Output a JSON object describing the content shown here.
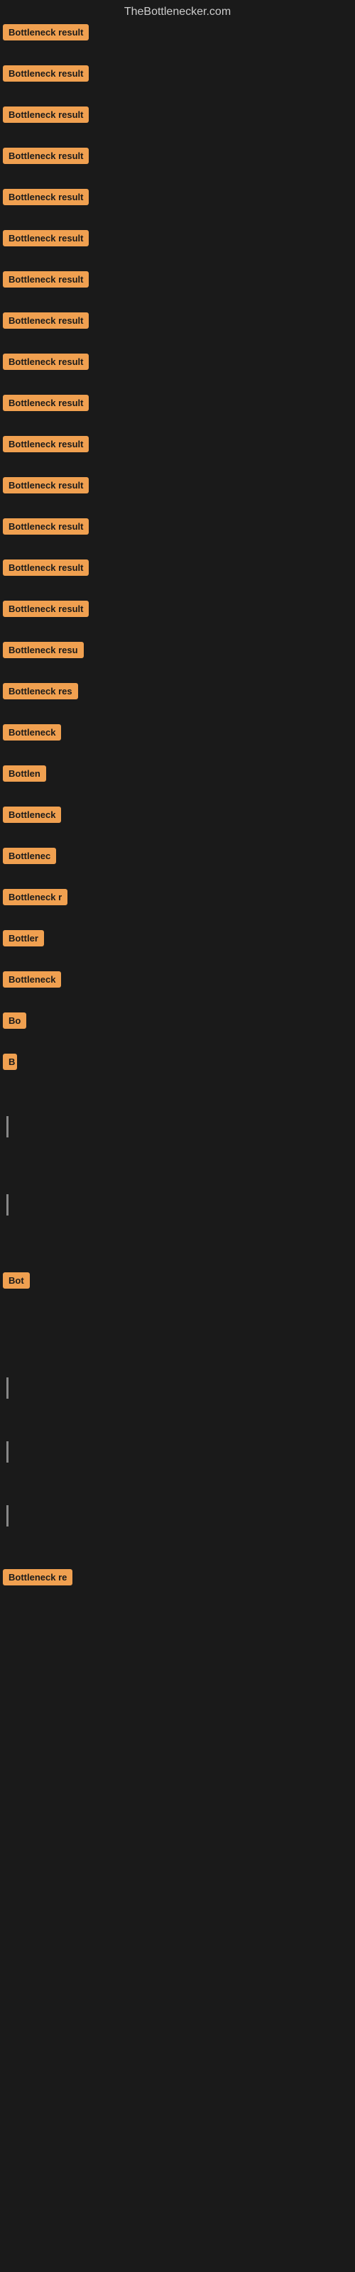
{
  "site": {
    "title": "TheBottlenecker.com"
  },
  "results": [
    {
      "id": 1,
      "label": "Bottleneck result",
      "width_class": "full",
      "top_spacing": 0
    },
    {
      "id": 2,
      "label": "Bottleneck result",
      "width_class": "full",
      "top_spacing": 30
    },
    {
      "id": 3,
      "label": "Bottleneck result",
      "width_class": "full",
      "top_spacing": 30
    },
    {
      "id": 4,
      "label": "Bottleneck result",
      "width_class": "full",
      "top_spacing": 30
    },
    {
      "id": 5,
      "label": "Bottleneck result",
      "width_class": "full",
      "top_spacing": 30
    },
    {
      "id": 6,
      "label": "Bottleneck result",
      "width_class": "full",
      "top_spacing": 30
    },
    {
      "id": 7,
      "label": "Bottleneck result",
      "width_class": "full",
      "top_spacing": 30
    },
    {
      "id": 8,
      "label": "Bottleneck result",
      "width_class": "full",
      "top_spacing": 30
    },
    {
      "id": 9,
      "label": "Bottleneck result",
      "width_class": "full",
      "top_spacing": 30
    },
    {
      "id": 10,
      "label": "Bottleneck result",
      "width_class": "full",
      "top_spacing": 30
    },
    {
      "id": 11,
      "label": "Bottleneck result",
      "width_class": "full",
      "top_spacing": 30
    },
    {
      "id": 12,
      "label": "Bottleneck result",
      "width_class": "full",
      "top_spacing": 30
    },
    {
      "id": 13,
      "label": "Bottleneck result",
      "width_class": "full",
      "top_spacing": 30
    },
    {
      "id": 14,
      "label": "Bottleneck result",
      "width_class": "full",
      "top_spacing": 30
    },
    {
      "id": 15,
      "label": "Bottleneck result",
      "width_class": "w155",
      "top_spacing": 30
    },
    {
      "id": 16,
      "label": "Bottleneck resu",
      "width_class": "w140",
      "top_spacing": 30
    },
    {
      "id": 17,
      "label": "Bottleneck res",
      "width_class": "w130",
      "top_spacing": 30
    },
    {
      "id": 18,
      "label": "Bottleneck",
      "width_class": "w100",
      "top_spacing": 30
    },
    {
      "id": 19,
      "label": "Bottlen",
      "width_class": "w80",
      "top_spacing": 30
    },
    {
      "id": 20,
      "label": "Bottleneck",
      "width_class": "w100",
      "top_spacing": 30
    },
    {
      "id": 21,
      "label": "Bottlenec",
      "width_class": "w90",
      "top_spacing": 30
    },
    {
      "id": 22,
      "label": "Bottleneck r",
      "width_class": "w110",
      "top_spacing": 30
    },
    {
      "id": 23,
      "label": "Bottler",
      "width_class": "w70",
      "top_spacing": 30
    },
    {
      "id": 24,
      "label": "Bottleneck",
      "width_class": "w100",
      "top_spacing": 30
    },
    {
      "id": 25,
      "label": "Bo",
      "width_class": "w40",
      "top_spacing": 30
    },
    {
      "id": 26,
      "label": "B",
      "width_class": "w20",
      "top_spacing": 30
    },
    {
      "id": 27,
      "label": "",
      "width_class": "w15",
      "top_spacing": 60
    },
    {
      "id": 28,
      "label": "",
      "width_class": "w15",
      "top_spacing": 80
    },
    {
      "id": 29,
      "label": "Bot",
      "width_class": "w50",
      "top_spacing": 80
    },
    {
      "id": 30,
      "label": "",
      "width_class": "w15",
      "top_spacing": 120
    },
    {
      "id": 31,
      "label": "",
      "width_class": "w15",
      "top_spacing": 60
    },
    {
      "id": 32,
      "label": "",
      "width_class": "w15",
      "top_spacing": 60
    },
    {
      "id": 33,
      "label": "Bottleneck re",
      "width_class": "w120",
      "top_spacing": 60
    }
  ],
  "colors": {
    "badge_bg": "#f0a050",
    "badge_text": "#1a1a1a",
    "background": "#1a1a1a",
    "site_title": "#cccccc"
  }
}
